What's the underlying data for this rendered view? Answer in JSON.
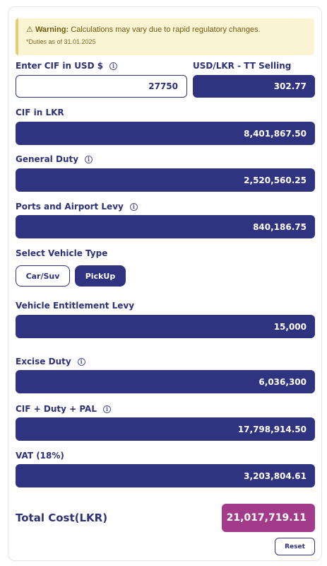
{
  "warning": {
    "icon": "warning-triangle-icon",
    "bold": "Warning:",
    "text": "Calculations may vary due to rapid regulatory changes.",
    "note": "*Duties as of 31.01.2025"
  },
  "cif_usd": {
    "label": "Enter CIF in USD $",
    "value": "27750"
  },
  "rate": {
    "label": "USD/LKR - TT Selling",
    "value": "302.77"
  },
  "cif_lkr": {
    "label": "CIF in LKR",
    "value": "8,401,867.50"
  },
  "general_duty": {
    "label": "General Duty",
    "value": "2,520,560.25"
  },
  "pal": {
    "label": "Ports and Airport Levy",
    "value": "840,186.75"
  },
  "vehicle_type": {
    "label": "Select Vehicle Type",
    "options": [
      "Car/Suv",
      "PickUp"
    ],
    "selected": "PickUp"
  },
  "entitlement": {
    "label": "Vehicle Entitlement Levy",
    "value": "15,000"
  },
  "excise": {
    "label": "Excise Duty",
    "value": "6,036,300"
  },
  "cif_duty_pal": {
    "label": "CIF + Duty + PAL",
    "value": "17,798,914.50"
  },
  "vat": {
    "label": "VAT (18%)",
    "value": "3,203,804.61"
  },
  "total": {
    "label": "Total Cost(LKR)",
    "value": "21,017,719.11"
  },
  "reset_label": "Reset",
  "info_glyph": "i",
  "colors": {
    "primary": "#2f3380",
    "total": "#a13b8a",
    "warning_bg": "#fbf4d2"
  }
}
